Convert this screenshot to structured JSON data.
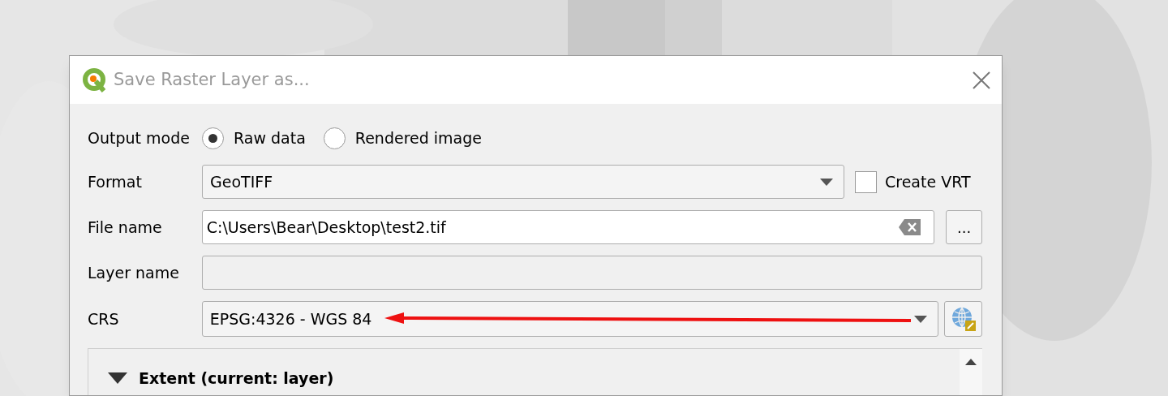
{
  "window": {
    "title": "Save Raster Layer as..."
  },
  "output_mode": {
    "label": "Output mode",
    "options": [
      {
        "label": "Raw data",
        "selected": true
      },
      {
        "label": "Rendered image",
        "selected": false
      }
    ]
  },
  "format": {
    "label": "Format",
    "value": "GeoTIFF",
    "create_vrt": {
      "label": "Create VRT",
      "checked": false
    }
  },
  "file_name": {
    "label": "File name",
    "value": "C:\\Users\\Bear\\Desktop\\test2.tif",
    "browse_button": "..."
  },
  "layer_name": {
    "label": "Layer name",
    "disabled": true
  },
  "crs": {
    "label": "CRS",
    "value": "EPSG:4326 - WGS 84"
  },
  "extent": {
    "title": "Extent (current: layer)",
    "expanded": true
  }
}
